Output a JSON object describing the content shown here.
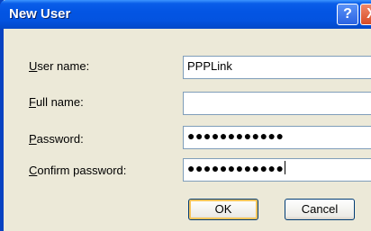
{
  "window": {
    "title": "New User"
  },
  "title_buttons": {
    "help": "?",
    "close": "X"
  },
  "form": {
    "username": {
      "label_first": "U",
      "label_rest": "ser name:",
      "value": "PPPLink"
    },
    "fullname": {
      "label_first": "F",
      "label_rest": "ull name:",
      "value": ""
    },
    "password": {
      "label_first": "P",
      "label_rest": "assword:",
      "value": "●●●●●●●●●●●●"
    },
    "confirm": {
      "label_first": "C",
      "label_rest": "onfirm password:",
      "value": "●●●●●●●●●●●●"
    }
  },
  "buttons": {
    "ok": "OK",
    "cancel": "Cancel"
  }
}
